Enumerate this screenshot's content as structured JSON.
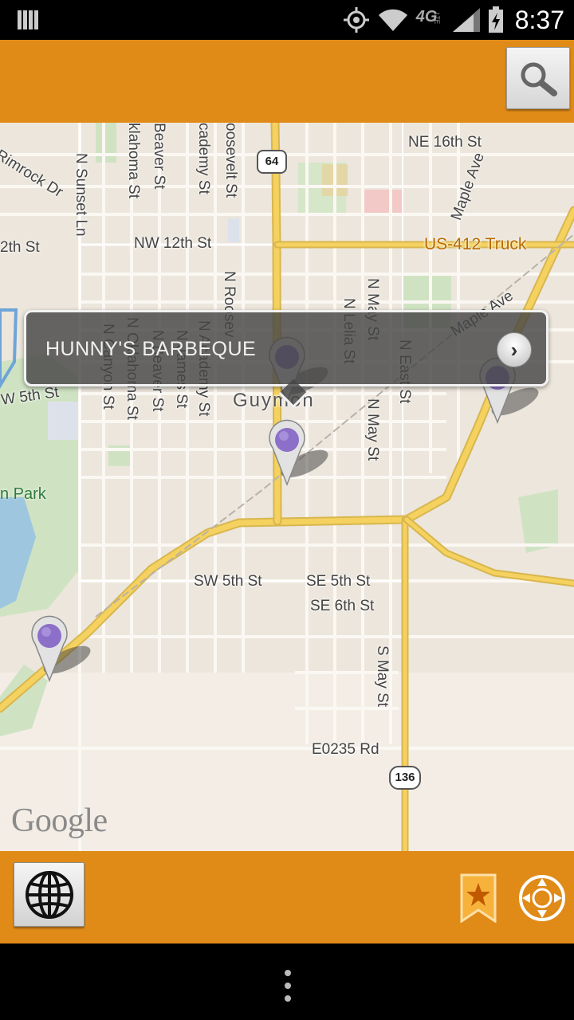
{
  "status_bar": {
    "time": "8:37",
    "network": "4G",
    "network_sub": "LTE",
    "icons": [
      "notification-icon",
      "gps-icon",
      "wifi-icon",
      "signal-icon",
      "battery-charging-icon"
    ]
  },
  "action_bar": {
    "search_icon": "search-icon",
    "color": "#e08a18"
  },
  "map": {
    "streets": {
      "rimrock": "Rimrock Dr",
      "nw12_left": "2th St",
      "n_sunset": "N Sunset Ln",
      "oklahoma_top": "klahoma St",
      "beaver_top": "Beaver St",
      "academy_top": "cademy St",
      "roosevelt_top": "oosevelt St",
      "nw12": "NW 12th St",
      "ne16": "NE 16th St",
      "maple_top": "Maple Ave",
      "us412": "US-412 Truck",
      "maple_mid": "Maple Ave",
      "n_roosevelt": "N Roosev",
      "n_may_top": "N May St",
      "n_lelia": "N Lelia St",
      "n_east": "N East St",
      "w5_left": "W 5th St",
      "canyon": "N Canyon St",
      "n_oklahoma": "N Oklahoma St",
      "n_beaver": "N Beaver St",
      "n_james": "N James St",
      "n_academy": "N Academy St",
      "n_may_mid": "N May St",
      "sw5": "SW 5th St",
      "se5": "SE 5th St",
      "se6": "SE 6th St",
      "s_may": "S May St",
      "e0235": "E0235 Rd"
    },
    "city": "Guymon",
    "park": "n Park",
    "shields": {
      "us64": "64",
      "hwy136": "136"
    },
    "callout": {
      "title": "HUNNY'S BARBEQUE",
      "arrow": "›"
    },
    "attribution": "Google"
  },
  "bottom_bar": {
    "globe_icon": "globe-icon",
    "bookmark_icon": "bookmark-star-icon",
    "locate_icon": "locate-icon"
  },
  "nav_bar": {
    "menu_icon": "overflow-menu-icon"
  }
}
